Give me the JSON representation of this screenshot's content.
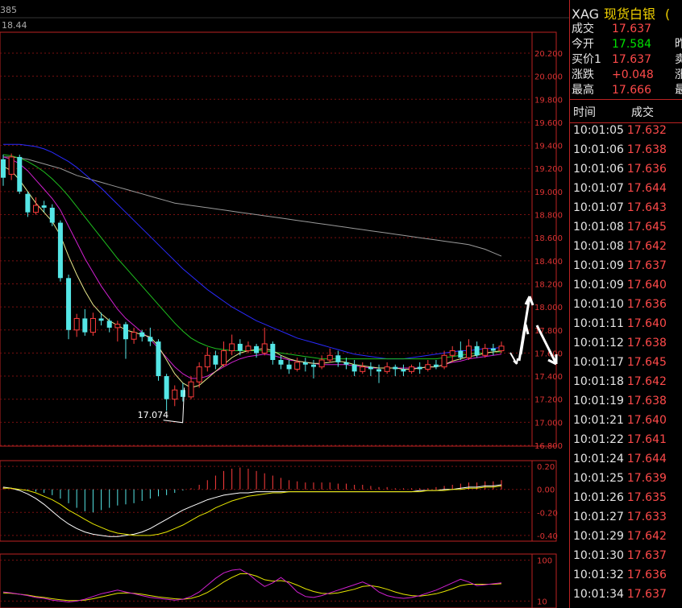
{
  "top_bar": {
    "value1": "385",
    "value2": "18.44"
  },
  "quote_panel": {
    "symbol": "XAG",
    "name": "现货白银",
    "tail": "(",
    "rows": [
      {
        "label": "成交",
        "value": "17.637",
        "color": "#ff4a4a",
        "extra": ""
      },
      {
        "label": "今开",
        "value": "17.584",
        "color": "#00e000",
        "extra": "昨"
      },
      {
        "label": "买价1",
        "value": "17.637",
        "color": "#ff4a4a",
        "extra": "卖"
      },
      {
        "label": "涨跌",
        "value": "+0.048",
        "color": "#ff4a4a",
        "extra": "涨"
      },
      {
        "label": "最高",
        "value": "17.666",
        "color": "#ff4a4a",
        "extra": "最"
      }
    ],
    "ticks_header": {
      "time": "时间",
      "price": "成交"
    },
    "ticks": [
      {
        "time": "10:01:05",
        "price": "17.632"
      },
      {
        "time": "10:01:06",
        "price": "17.638"
      },
      {
        "time": "10:01:06",
        "price": "17.636"
      },
      {
        "time": "10:01:07",
        "price": "17.644"
      },
      {
        "time": "10:01:07",
        "price": "17.643"
      },
      {
        "time": "10:01:08",
        "price": "17.645"
      },
      {
        "time": "10:01:08",
        "price": "17.642"
      },
      {
        "time": "10:01:09",
        "price": "17.637"
      },
      {
        "time": "10:01:09",
        "price": "17.640"
      },
      {
        "time": "10:01:10",
        "price": "17.636"
      },
      {
        "time": "10:01:11",
        "price": "17.640"
      },
      {
        "time": "10:01:12",
        "price": "17.638"
      },
      {
        "time": "10:01:17",
        "price": "17.645"
      },
      {
        "time": "10:01:18",
        "price": "17.642"
      },
      {
        "time": "10:01:19",
        "price": "17.638"
      },
      {
        "time": "10:01:21",
        "price": "17.640"
      },
      {
        "time": "10:01:22",
        "price": "17.641"
      },
      {
        "time": "10:01:24",
        "price": "17.644"
      },
      {
        "time": "10:01:25",
        "price": "17.639"
      },
      {
        "time": "10:01:26",
        "price": "17.635"
      },
      {
        "time": "10:01:27",
        "price": "17.633"
      },
      {
        "time": "10:01:29",
        "price": "17.642"
      },
      {
        "time": "10:01:30",
        "price": "17.637"
      },
      {
        "time": "10:01:32",
        "price": "17.636"
      },
      {
        "time": "10:01:34",
        "price": "17.637"
      }
    ]
  },
  "chart_data": {
    "type": "candlestick",
    "y_ticks": [
      "20.200",
      "20.000",
      "19.800",
      "19.600",
      "19.400",
      "19.200",
      "19.000",
      "18.800",
      "18.600",
      "18.400",
      "18.200",
      "18.000",
      "17.800",
      "17.600",
      "17.400",
      "17.200",
      "17.000",
      "16.800"
    ],
    "ylim": [
      16.8,
      20.3
    ],
    "low_annotation": "17.074",
    "low_value": 17.074,
    "candles": [
      [
        19.28,
        19.12,
        19.32,
        19.05
      ],
      [
        19.15,
        19.3,
        19.33,
        19.1
      ],
      [
        19.3,
        19.0,
        19.32,
        18.98
      ],
      [
        18.98,
        18.82,
        19.0,
        18.78
      ],
      [
        18.82,
        18.88,
        18.95,
        18.8
      ],
      [
        18.88,
        18.86,
        18.92,
        18.82
      ],
      [
        18.86,
        18.73,
        18.89,
        18.7
      ],
      [
        18.73,
        18.25,
        18.75,
        18.22
      ],
      [
        18.25,
        17.8,
        18.28,
        17.72
      ],
      [
        17.8,
        17.9,
        17.94,
        17.74
      ],
      [
        17.9,
        17.78,
        17.98,
        17.75
      ],
      [
        17.78,
        17.9,
        17.95,
        17.75
      ],
      [
        17.9,
        17.88,
        17.95,
        17.84
      ],
      [
        17.88,
        17.82,
        17.9,
        17.78
      ],
      [
        17.82,
        17.85,
        17.88,
        17.7
      ],
      [
        17.85,
        17.72,
        17.87,
        17.55
      ],
      [
        17.72,
        17.78,
        17.82,
        17.68
      ],
      [
        17.78,
        17.74,
        17.8,
        17.7
      ],
      [
        17.74,
        17.7,
        17.82,
        17.66
      ],
      [
        17.7,
        17.4,
        17.72,
        17.36
      ],
      [
        17.4,
        17.2,
        17.42,
        17.1
      ],
      [
        17.2,
        17.28,
        17.32,
        17.14
      ],
      [
        17.28,
        17.22,
        17.34,
        17.18
      ],
      [
        17.22,
        17.35,
        17.4,
        17.2
      ],
      [
        17.35,
        17.48,
        17.52,
        17.3
      ],
      [
        17.48,
        17.58,
        17.65,
        17.44
      ],
      [
        17.58,
        17.5,
        17.62,
        17.46
      ],
      [
        17.5,
        17.62,
        17.7,
        17.48
      ],
      [
        17.62,
        17.68,
        17.76,
        17.58
      ],
      [
        17.68,
        17.62,
        17.72,
        17.58
      ],
      [
        17.62,
        17.66,
        17.7,
        17.6
      ],
      [
        17.66,
        17.6,
        17.68,
        17.56
      ],
      [
        17.6,
        17.68,
        17.82,
        17.58
      ],
      [
        17.68,
        17.54,
        17.7,
        17.5
      ],
      [
        17.54,
        17.5,
        17.58,
        17.46
      ],
      [
        17.5,
        17.46,
        17.54,
        17.42
      ],
      [
        17.46,
        17.52,
        17.56,
        17.44
      ],
      [
        17.52,
        17.5,
        17.56,
        17.44
      ],
      [
        17.5,
        17.48,
        17.54,
        17.38
      ],
      [
        17.48,
        17.54,
        17.58,
        17.46
      ],
      [
        17.54,
        17.58,
        17.64,
        17.52
      ],
      [
        17.58,
        17.52,
        17.62,
        17.48
      ],
      [
        17.52,
        17.5,
        17.56,
        17.46
      ],
      [
        17.5,
        17.44,
        17.54,
        17.4
      ],
      [
        17.44,
        17.48,
        17.52,
        17.42
      ],
      [
        17.48,
        17.46,
        17.52,
        17.4
      ],
      [
        17.46,
        17.44,
        17.5,
        17.34
      ],
      [
        17.44,
        17.48,
        17.52,
        17.42
      ],
      [
        17.48,
        17.46,
        17.5,
        17.4
      ],
      [
        17.46,
        17.44,
        17.5,
        17.4
      ],
      [
        17.44,
        17.48,
        17.5,
        17.42
      ],
      [
        17.48,
        17.46,
        17.52,
        17.42
      ],
      [
        17.46,
        17.5,
        17.54,
        17.44
      ],
      [
        17.5,
        17.48,
        17.54,
        17.46
      ],
      [
        17.48,
        17.58,
        17.62,
        17.46
      ],
      [
        17.58,
        17.62,
        17.66,
        17.52
      ],
      [
        17.62,
        17.56,
        17.7,
        17.54
      ],
      [
        17.56,
        17.66,
        17.72,
        17.54
      ],
      [
        17.66,
        17.58,
        17.7,
        17.56
      ],
      [
        17.58,
        17.64,
        17.68,
        17.56
      ],
      [
        17.64,
        17.62,
        17.68,
        17.58
      ],
      [
        17.62,
        17.66,
        17.7,
        17.6
      ]
    ],
    "ma_white": [
      19.4,
      19.4,
      19.39,
      19.37,
      19.35,
      19.31,
      19.27,
      19.22,
      19.16,
      19.1,
      19.04,
      18.98,
      18.92,
      18.86,
      18.8,
      18.74,
      18.68,
      18.62,
      18.56,
      18.5,
      18.44,
      18.38,
      18.32,
      18.27,
      18.22,
      18.17,
      18.12,
      18.07,
      18.02,
      17.98,
      17.94,
      17.9,
      17.87,
      17.84,
      17.81,
      17.78,
      17.75,
      17.72,
      17.69,
      17.67,
      17.65,
      17.63,
      17.61,
      17.6,
      17.59,
      17.58,
      17.57,
      17.56,
      17.55,
      17.55,
      17.55,
      17.55,
      17.56,
      17.56,
      17.57,
      17.57,
      17.58,
      17.59,
      17.6,
      17.61,
      17.62,
      17.62
    ],
    "ma_blue": [
      19.41,
      19.41,
      19.41,
      19.4,
      19.39,
      19.37,
      19.34,
      19.3,
      19.26,
      19.21,
      19.15,
      19.09,
      19.03,
      18.96,
      18.89,
      18.82,
      18.75,
      18.68,
      18.61,
      18.54,
      18.47,
      18.4,
      18.33,
      18.27,
      18.21,
      18.15,
      18.1,
      18.05,
      18.0,
      17.96,
      17.92,
      17.88,
      17.85,
      17.82,
      17.79,
      17.76,
      17.73,
      17.71,
      17.69,
      17.67,
      17.65,
      17.63,
      17.61,
      17.59,
      17.58,
      17.57,
      17.56,
      17.55,
      17.55,
      17.55,
      17.56,
      17.57,
      17.58,
      17.59,
      17.6,
      17.61,
      17.62,
      17.62,
      17.63,
      17.64,
      17.64,
      17.65
    ],
    "ma_gray": [
      19.3,
      19.3,
      19.29,
      19.28,
      19.26,
      19.24,
      19.22,
      19.2,
      19.17,
      19.14,
      19.12,
      19.1,
      19.08,
      19.06,
      19.04,
      19.02,
      19.0,
      18.98,
      18.96,
      18.94,
      18.92,
      18.9,
      18.89,
      18.88,
      18.87,
      18.86,
      18.85,
      18.84,
      18.83,
      18.82,
      18.81,
      18.8,
      18.79,
      18.78,
      18.77,
      18.76,
      18.75,
      18.74,
      18.73,
      18.72,
      18.71,
      18.7,
      18.69,
      18.68,
      18.67,
      18.66,
      18.65,
      18.64,
      18.63,
      18.62,
      18.61,
      18.6,
      18.59,
      18.58,
      18.57,
      18.56,
      18.55,
      18.54,
      18.52,
      18.5,
      18.47,
      18.44
    ],
    "ma_yellow": [
      19.22,
      19.18,
      19.1,
      19.0,
      18.9,
      18.82,
      18.74,
      18.62,
      18.44,
      18.28,
      18.14,
      18.02,
      17.94,
      17.88,
      17.84,
      17.8,
      17.78,
      17.76,
      17.74,
      17.66,
      17.54,
      17.42,
      17.34,
      17.3,
      17.32,
      17.38,
      17.44,
      17.5,
      17.56,
      17.6,
      17.62,
      17.63,
      17.64,
      17.62,
      17.58,
      17.55,
      17.53,
      17.52,
      17.51,
      17.51,
      17.52,
      17.53,
      17.52,
      17.5,
      17.49,
      17.48,
      17.47,
      17.47,
      17.47,
      17.46,
      17.46,
      17.47,
      17.48,
      17.48,
      17.5,
      17.53,
      17.55,
      17.57,
      17.58,
      17.6,
      17.61,
      17.62
    ],
    "ma_magenta": [
      19.3,
      19.28,
      19.24,
      19.18,
      19.1,
      19.02,
      18.94,
      18.84,
      18.7,
      18.56,
      18.42,
      18.3,
      18.18,
      18.08,
      17.98,
      17.9,
      17.84,
      17.78,
      17.72,
      17.64,
      17.56,
      17.48,
      17.42,
      17.38,
      17.38,
      17.4,
      17.44,
      17.48,
      17.52,
      17.55,
      17.57,
      17.58,
      17.59,
      17.58,
      17.56,
      17.54,
      17.53,
      17.52,
      17.51,
      17.5,
      17.5,
      17.5,
      17.5,
      17.49,
      17.48,
      17.47,
      17.47,
      17.47,
      17.47,
      17.47,
      17.47,
      17.47,
      17.48,
      17.48,
      17.5,
      17.52,
      17.53,
      17.55,
      17.56,
      17.57,
      17.58,
      17.59
    ],
    "ma_green": [
      19.32,
      19.31,
      19.29,
      19.26,
      19.22,
      19.17,
      19.11,
      19.04,
      18.96,
      18.87,
      18.78,
      18.69,
      18.6,
      18.51,
      18.42,
      18.34,
      18.26,
      18.18,
      18.1,
      18.02,
      17.94,
      17.86,
      17.79,
      17.73,
      17.69,
      17.66,
      17.64,
      17.63,
      17.62,
      17.62,
      17.62,
      17.62,
      17.62,
      17.61,
      17.6,
      17.59,
      17.58,
      17.57,
      17.56,
      17.55,
      17.55,
      17.55,
      17.55,
      17.55,
      17.55,
      17.55,
      17.55,
      17.55,
      17.55,
      17.55,
      17.55,
      17.55,
      17.55,
      17.55,
      17.56,
      17.57,
      17.58,
      17.59,
      17.6,
      17.6,
      17.61,
      17.61
    ],
    "macd_ticks": [
      "0.20",
      "0.00",
      "-0.20",
      "-0.40"
    ],
    "macd_ylim": [
      -0.45,
      0.25
    ],
    "macd_hist": [
      0.02,
      0.01,
      0.0,
      -0.01,
      -0.02,
      -0.03,
      -0.05,
      -0.08,
      -0.12,
      -0.16,
      -0.19,
      -0.2,
      -0.18,
      -0.16,
      -0.14,
      -0.13,
      -0.12,
      -0.1,
      -0.08,
      -0.06,
      -0.05,
      -0.03,
      -0.01,
      0.01,
      0.04,
      0.08,
      0.12,
      0.16,
      0.18,
      0.19,
      0.18,
      0.16,
      0.14,
      0.12,
      0.1,
      0.08,
      0.07,
      0.06,
      0.06,
      0.06,
      0.06,
      0.05,
      0.05,
      0.04,
      0.04,
      0.03,
      0.02,
      0.02,
      0.01,
      0.01,
      0.01,
      0.01,
      0.01,
      0.02,
      0.03,
      0.04,
      0.05,
      0.06,
      0.06,
      0.07,
      0.07,
      0.08
    ],
    "macd_dif": [
      0.02,
      0.01,
      -0.01,
      -0.04,
      -0.08,
      -0.13,
      -0.19,
      -0.25,
      -0.3,
      -0.34,
      -0.37,
      -0.39,
      -0.4,
      -0.41,
      -0.41,
      -0.4,
      -0.39,
      -0.37,
      -0.34,
      -0.3,
      -0.26,
      -0.22,
      -0.18,
      -0.15,
      -0.12,
      -0.09,
      -0.07,
      -0.05,
      -0.04,
      -0.03,
      -0.03,
      -0.02,
      -0.02,
      -0.02,
      -0.02,
      -0.02,
      -0.02,
      -0.02,
      -0.02,
      -0.02,
      -0.02,
      -0.02,
      -0.02,
      -0.02,
      -0.02,
      -0.02,
      -0.02,
      -0.02,
      -0.02,
      -0.02,
      -0.02,
      -0.01,
      -0.01,
      -0.01,
      0.0,
      0.0,
      0.01,
      0.02,
      0.02,
      0.03,
      0.03,
      0.04
    ],
    "macd_dea": [
      0.01,
      0.01,
      0.0,
      -0.01,
      -0.03,
      -0.06,
      -0.09,
      -0.13,
      -0.18,
      -0.22,
      -0.26,
      -0.3,
      -0.33,
      -0.36,
      -0.38,
      -0.39,
      -0.4,
      -0.4,
      -0.4,
      -0.39,
      -0.37,
      -0.34,
      -0.31,
      -0.27,
      -0.23,
      -0.2,
      -0.16,
      -0.13,
      -0.1,
      -0.08,
      -0.06,
      -0.05,
      -0.04,
      -0.03,
      -0.03,
      -0.02,
      -0.02,
      -0.02,
      -0.02,
      -0.02,
      -0.02,
      -0.02,
      -0.02,
      -0.02,
      -0.02,
      -0.02,
      -0.02,
      -0.02,
      -0.02,
      -0.02,
      -0.02,
      -0.02,
      -0.01,
      -0.01,
      -0.01,
      0.0,
      0.0,
      0.01,
      0.01,
      0.02,
      0.02,
      0.03
    ],
    "osc_ticks": [
      "100",
      "10"
    ],
    "osc_ylim": [
      0,
      110
    ],
    "osc_k": [
      30,
      28,
      25,
      22,
      18,
      16,
      12,
      10,
      8,
      10,
      14,
      20,
      26,
      30,
      34,
      30,
      26,
      22,
      18,
      16,
      14,
      12,
      14,
      20,
      30,
      45,
      60,
      72,
      78,
      80,
      70,
      55,
      42,
      50,
      62,
      48,
      30,
      20,
      18,
      22,
      28,
      34,
      40,
      46,
      52,
      44,
      30,
      22,
      18,
      16,
      18,
      22,
      28,
      34,
      42,
      50,
      58,
      52,
      44,
      46,
      48,
      50
    ],
    "osc_d": [
      28,
      27,
      25,
      23,
      20,
      18,
      15,
      13,
      11,
      11,
      12,
      15,
      19,
      23,
      27,
      28,
      27,
      25,
      22,
      19,
      17,
      15,
      14,
      16,
      21,
      29,
      40,
      52,
      62,
      70,
      70,
      65,
      57,
      54,
      55,
      52,
      45,
      37,
      31,
      27,
      26,
      28,
      32,
      36,
      42,
      44,
      41,
      36,
      30,
      25,
      22,
      21,
      23,
      26,
      31,
      37,
      44,
      47,
      47,
      47,
      47,
      48
    ]
  }
}
